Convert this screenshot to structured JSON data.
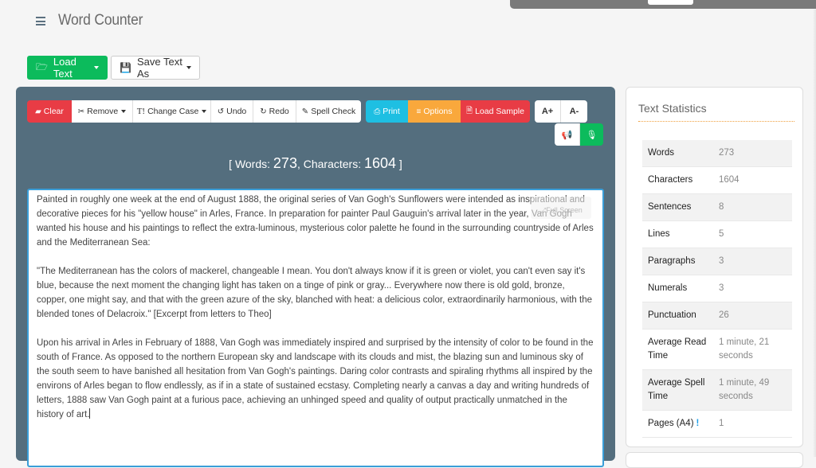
{
  "app": {
    "title": "Word Counter"
  },
  "file_buttons": {
    "load_text": "Load Text",
    "save_text_as": "Save Text As"
  },
  "toolbar": {
    "clear": "Clear",
    "remove": "Remove",
    "change_case": "Change Case",
    "undo": "Undo",
    "redo": "Redo",
    "spell_check": "Spell Check",
    "print": "Print",
    "options": "Options",
    "load_sample": "Load Sample",
    "font_increase": "A+",
    "font_decrease": "A-"
  },
  "counter": {
    "words_label": "Words:",
    "words_value": "273",
    "chars_label": "Characters:",
    "chars_value": "1604"
  },
  "editor": {
    "fullscreen_hint": "Full Screen",
    "paragraphs": [
      "Painted in roughly one week at the end of August 1888, the original series of Van Gogh's Sunflowers were intended as inspirational and decorative pieces for his \"yellow house\" in Arles, France. In preparation for painter Paul Gauguin's arrival later in the year, Van Gogh wanted his house and his paintings to reflect the extra-luminous, mysterious color palette he found in the surrounding countryside of Arles and the Mediterranean Sea:",
      "\"The Mediterranean has the colors of mackerel, changeable I mean. You don't always know if it is green or violet, you can't even say it's blue, because the next moment the changing light has taken on a tinge of pink or gray... Everywhere now there is old gold, bronze, copper, one might say, and that with the green azure of the sky, blanched with heat: a delicious color, extraordinarily harmonious, with the blended tones of Delacroix.\" [Excerpt from letters to Theo]",
      "Upon his arrival in Arles in February of 1888, Van Gogh was immediately inspired and surprised by the intensity of color to be found in the south of France. As opposed to the northern European sky and landscape with its clouds and mist, the blazing sun and luminous sky of the south seem to have banished all hesitation from Van Gogh's paintings. Daring color contrasts and spiraling rhythms all inspired by the environs of Arles began to flow endlessly, as if in a state of sustained ecstasy. Completing nearly a canvas a day and writing hundreds of letters, 1888 saw Van Gogh paint at a furious pace, achieving an unhinged speed and quality of output practically unmatched in the history of art."
    ]
  },
  "stats": {
    "title": "Text Statistics",
    "rows": [
      {
        "label": "Words",
        "value": "273"
      },
      {
        "label": "Characters",
        "value": "1604"
      },
      {
        "label": "Sentences",
        "value": "8"
      },
      {
        "label": "Lines",
        "value": "5"
      },
      {
        "label": "Paragraphs",
        "value": "3"
      },
      {
        "label": "Numerals",
        "value": "3"
      },
      {
        "label": "Punctuation",
        "value": "26"
      },
      {
        "label": "Average Read Time",
        "value": "1 minute, 21 seconds"
      },
      {
        "label": "Average Spell Time",
        "value": "1 minute, 49 seconds"
      },
      {
        "label": "Pages (A4)",
        "value": "1"
      }
    ]
  },
  "colors": {
    "green": "#0cbb5c",
    "red": "#e83c45",
    "cyan": "#1ebfe2",
    "orange": "#f9a83c",
    "panel": "#546e7e",
    "info_blue": "#1e9ee8"
  }
}
